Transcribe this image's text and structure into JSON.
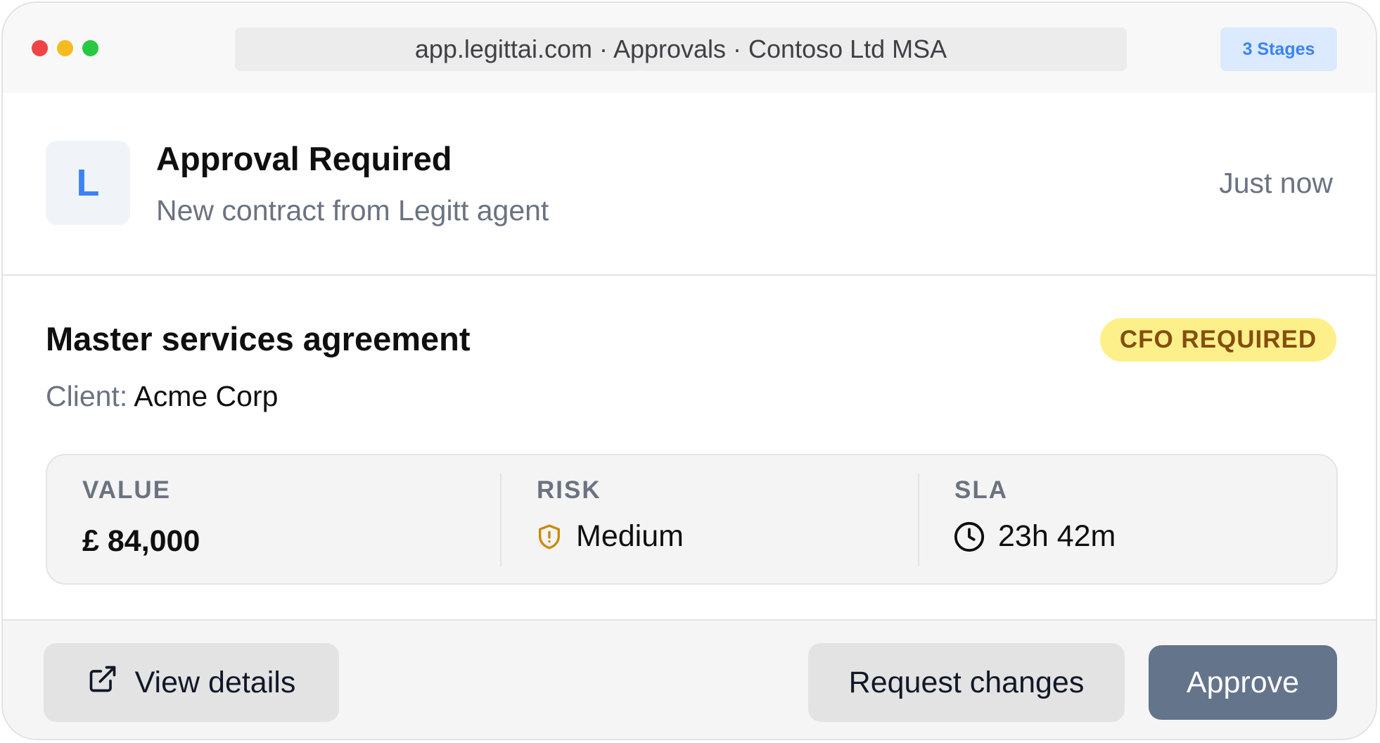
{
  "window": {
    "address": "app.legittai.com · Approvals · Contoso Ltd MSA",
    "stages_badge": "3 Stages"
  },
  "notification": {
    "avatar_letter": "L",
    "title": "Approval Required",
    "subtitle": "New contract from Legitt agent",
    "timestamp": "Just now"
  },
  "contract": {
    "title": "Master services agreement",
    "badge": "CFO REQUIRED",
    "client_label": "Client:",
    "client_value": "Acme Corp"
  },
  "metrics": {
    "value": {
      "label": "VALUE",
      "value": "£ 84,000"
    },
    "risk": {
      "label": "RISK",
      "value": "Medium",
      "icon": "shield-alert-icon"
    },
    "sla": {
      "label": "SLA",
      "value": "23h 42m",
      "icon": "clock-icon"
    }
  },
  "actions": {
    "view_details": "View details",
    "request_changes": "Request changes",
    "approve": "Approve"
  },
  "colors": {
    "accent_blue": "#3b82f6",
    "badge_yellow": "#fdf08a",
    "badge_yellow_text": "#854d0e",
    "risk_icon": "#ca8a04",
    "approve_button": "#64748b"
  }
}
